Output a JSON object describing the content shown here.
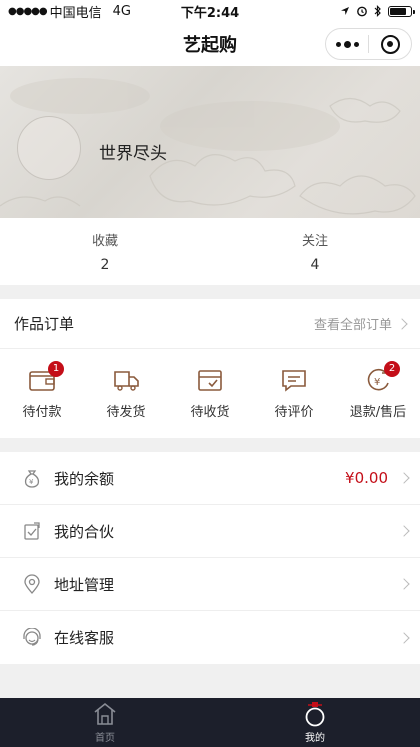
{
  "status": {
    "carrier": "中国电信",
    "network": "4G",
    "time": "下午2:44"
  },
  "nav": {
    "title": "艺起购"
  },
  "profile": {
    "username": "世界尽头"
  },
  "stats": [
    {
      "label": "收藏",
      "value": "2"
    },
    {
      "label": "关注",
      "value": "4"
    }
  ],
  "orders": {
    "title": "作品订单",
    "view_all": "查看全部订单",
    "items": [
      {
        "label": "待付款",
        "icon": "wallet-icon",
        "badge": "1"
      },
      {
        "label": "待发货",
        "icon": "truck-icon",
        "badge": ""
      },
      {
        "label": "待收货",
        "icon": "box-icon",
        "badge": ""
      },
      {
        "label": "待评价",
        "icon": "comment-icon",
        "badge": ""
      },
      {
        "label": "退款/售后",
        "icon": "refund-icon",
        "badge": "2"
      }
    ]
  },
  "menu": [
    {
      "label": "我的余额",
      "value": "¥0.00",
      "icon": "moneybag-icon"
    },
    {
      "label": "我的合伙",
      "value": "",
      "icon": "partner-icon"
    },
    {
      "label": "地址管理",
      "value": "",
      "icon": "location-icon"
    },
    {
      "label": "在线客服",
      "value": "",
      "icon": "service-icon"
    }
  ],
  "tabbar": [
    {
      "label": "首页",
      "icon": "home-icon"
    },
    {
      "label": "我的",
      "icon": "profile-icon"
    }
  ],
  "colors": {
    "accent": "#c40e18",
    "tabbar_bg": "#1c1f2b"
  }
}
